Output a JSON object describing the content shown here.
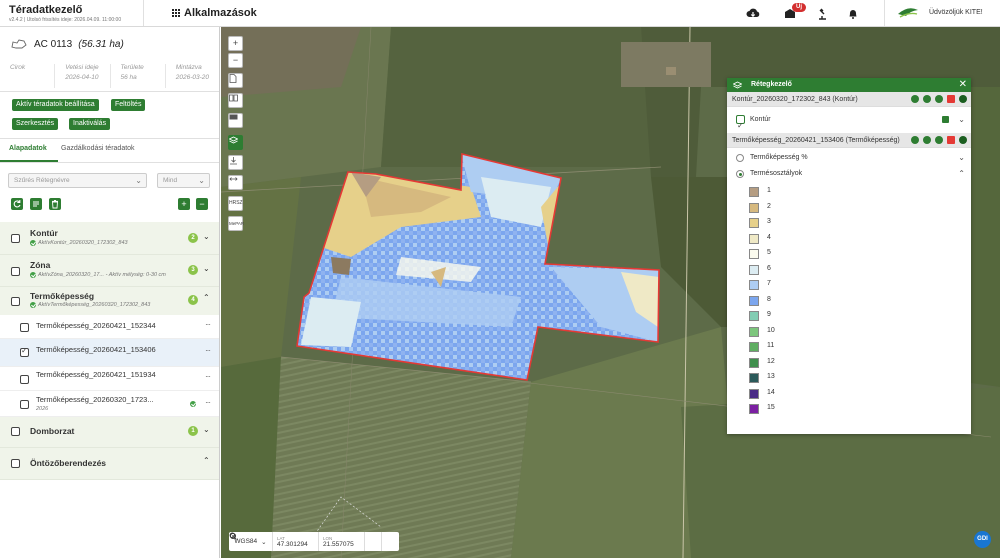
{
  "topbar": {
    "app_title": "Téradatkezelő",
    "version": "v2.4.2 | Utolsó frissítés ideje: 2026.04.09. 11:00:00",
    "apps_label": "Alkalmazások",
    "notification_count": "Új",
    "welcome": "Üdvözöljük KITE!",
    "logo_text": "KITE"
  },
  "field": {
    "name": "AC 0113",
    "area": "(56.31 ha)",
    "info": [
      {
        "label": "Cirok",
        "value": ""
      },
      {
        "label": "Vetési ideje",
        "value": "2026-04-10"
      },
      {
        "label": "Területe",
        "value": "56 ha"
      },
      {
        "label": "Mintázva",
        "value": "2026-03-20"
      }
    ]
  },
  "actions": {
    "active_settings": "Aktív téradatok beállítása",
    "upload": "Feltöltés",
    "edit": "Szerkesztés",
    "deactivate": "Inaktiválás"
  },
  "tabs": {
    "basic": "Alapadatok",
    "economic": "Gazdálkodási téradatok"
  },
  "filters": {
    "layer_placeholder": "Szűrés Rétegnévre",
    "mode": "Mind"
  },
  "groups": [
    {
      "title": "Kontúr",
      "sub": "AktívKontúr_20260320_172302_843",
      "count": "2"
    },
    {
      "title": "Zóna",
      "sub": "AktívZóna_20260320_17... - Aktív mélység: 0-30 cm",
      "count": "3"
    },
    {
      "title": "Termőképesség",
      "sub": "AktívTermőképesség_20260320_172302_843",
      "count": "4"
    },
    {
      "title": "Domborzat",
      "sub": "",
      "count": "1"
    },
    {
      "title": "Öntözőberendezés",
      "sub": "",
      "count": ""
    }
  ],
  "items": [
    {
      "name": "Termőképesség_20260421_152344",
      "sub": ""
    },
    {
      "name": "Termőképesség_20260421_153406",
      "sub": ""
    },
    {
      "name": "Termőképesség_20260421_151934",
      "sub": ""
    },
    {
      "name": "Termőképesség_20260320_1723...",
      "sub": "2026"
    }
  ],
  "map": {
    "controls": [
      "+",
      "−",
      "",
      "",
      "",
      "",
      "",
      "",
      "HRSZ",
      "MePAR"
    ],
    "crs": "WGS84",
    "lat_label": "LAT",
    "lat": "47.301294",
    "lon_label": "LON",
    "lon": "21.557075",
    "gdi": "GDI"
  },
  "layer_manager": {
    "title": "Rétegkezelő",
    "layer1": "Kontúr_20260320_172302_843 (Kontúr)",
    "layer1_row": "Kontúr",
    "layer2": "Termőképesség_20260421_153406 (Termőképesség)",
    "option1": "Termőképesség %",
    "option2": "Termésosztályok",
    "classes": [
      {
        "label": "1",
        "color": "#b59d82"
      },
      {
        "label": "2",
        "color": "#d6b97f"
      },
      {
        "label": "3",
        "color": "#e6d08a"
      },
      {
        "label": "4",
        "color": "#efe9c6"
      },
      {
        "label": "5",
        "color": "#fbfbee"
      },
      {
        "label": "6",
        "color": "#dcecf2"
      },
      {
        "label": "7",
        "color": "#aecdf2"
      },
      {
        "label": "8",
        "color": "#7ca6ee"
      },
      {
        "label": "9",
        "color": "#82cdb3"
      },
      {
        "label": "10",
        "color": "#7cc67c"
      },
      {
        "label": "11",
        "color": "#5fae62"
      },
      {
        "label": "12",
        "color": "#3f8f4d"
      },
      {
        "label": "13",
        "color": "#2b5a5a"
      },
      {
        "label": "14",
        "color": "#4a2c86"
      },
      {
        "label": "15",
        "color": "#7b1fa2"
      }
    ]
  },
  "colors": {
    "primary": "#2e7d32",
    "field_border": "#e53935"
  }
}
